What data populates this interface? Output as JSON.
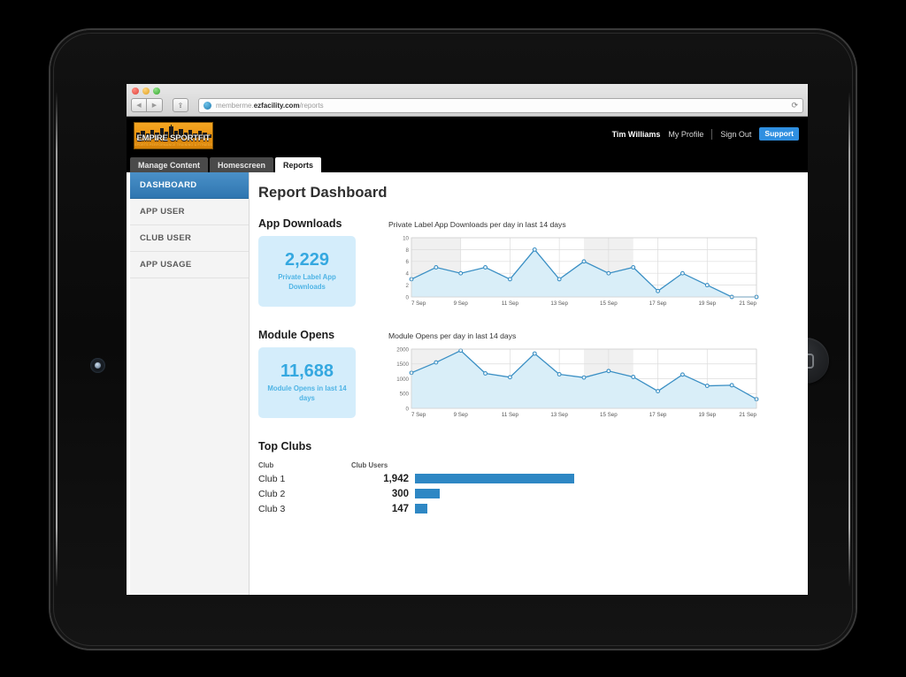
{
  "browser": {
    "url_sub": "memberme.",
    "url_host": "ezfacility.com",
    "url_path": "/reports",
    "back_icon": "◀",
    "forward_icon": "▶",
    "share_icon": "⇪",
    "reload_icon": "⟳"
  },
  "header": {
    "logo_text": "EMPIRE SPORTFIT",
    "logo_sub": "SPORTS PERFORMANCE TRAINING & FITNESS",
    "user_name": "Tim Williams",
    "my_profile": "My Profile",
    "sign_out": "Sign Out",
    "support": "Support",
    "support_color": "#2f8fe0"
  },
  "tabs": [
    {
      "label": "Manage Content",
      "active": false
    },
    {
      "label": "Homescreen",
      "active": false
    },
    {
      "label": "Reports",
      "active": true
    }
  ],
  "sidebar": {
    "items": [
      {
        "label": "DASHBOARD",
        "active": true
      },
      {
        "label": "APP USER",
        "active": false
      },
      {
        "label": "CLUB USER",
        "active": false
      },
      {
        "label": "APP USAGE",
        "active": false
      }
    ],
    "active_color": "#2f76b0"
  },
  "main": {
    "page_title": "Report Dashboard",
    "app_downloads": {
      "heading": "App Downloads",
      "stat_number": "2,229",
      "stat_caption": "Private Label App Downloads"
    },
    "module_opens": {
      "heading": "Module Opens",
      "stat_number": "11,688",
      "stat_caption": "Module Opens in last 14 days"
    },
    "top_clubs": {
      "heading": "Top Clubs",
      "col_club": "Club",
      "col_users": "Club Users"
    }
  },
  "chart_data": [
    {
      "type": "area",
      "title": "Private Label App Downloads per day in last 14 days",
      "xlabel": "",
      "ylabel": "",
      "categories": [
        "7 Sep",
        "8 Sep",
        "9 Sep",
        "10 Sep",
        "11 Sep",
        "12 Sep",
        "13 Sep",
        "14 Sep",
        "15 Sep",
        "16 Sep",
        "17 Sep",
        "18 Sep",
        "19 Sep",
        "20 Sep",
        "21 Sep"
      ],
      "values": [
        3,
        5,
        4,
        5,
        3,
        8,
        3,
        6,
        4,
        5,
        1,
        4,
        2,
        0,
        0
      ],
      "xticks": [
        "7 Sep",
        "9 Sep",
        "11 Sep",
        "13 Sep",
        "15 Sep",
        "17 Sep",
        "19 Sep",
        "21 Sep"
      ],
      "yticks": [
        0,
        2,
        4,
        6,
        8,
        10
      ],
      "ylim": [
        0,
        10
      ],
      "grid": true,
      "legend": "none",
      "line_color": "#3a8fc4",
      "fill_color": "#d9eef8",
      "marker": "open-circle",
      "weekend_bands": [
        [
          0,
          2
        ],
        [
          7,
          9
        ]
      ]
    },
    {
      "type": "area",
      "title": "Module Opens per day in last 14 days",
      "xlabel": "",
      "ylabel": "",
      "categories": [
        "7 Sep",
        "8 Sep",
        "9 Sep",
        "10 Sep",
        "11 Sep",
        "12 Sep",
        "13 Sep",
        "14 Sep",
        "15 Sep",
        "16 Sep",
        "17 Sep",
        "18 Sep",
        "19 Sep",
        "20 Sep",
        "21 Sep"
      ],
      "values": [
        1200,
        1550,
        1950,
        1180,
        1050,
        1850,
        1150,
        1040,
        1260,
        1060,
        580,
        1140,
        760,
        780,
        310
      ],
      "xticks": [
        "7 Sep",
        "9 Sep",
        "11 Sep",
        "13 Sep",
        "15 Sep",
        "17 Sep",
        "19 Sep",
        "21 Sep"
      ],
      "yticks": [
        0,
        500,
        1000,
        1500,
        2000
      ],
      "ylim": [
        0,
        2000
      ],
      "grid": true,
      "legend": "none",
      "line_color": "#3a8fc4",
      "fill_color": "#d9eef8",
      "marker": "open-circle",
      "weekend_bands": [
        [
          0,
          2
        ],
        [
          7,
          9
        ]
      ]
    },
    {
      "type": "bar",
      "title": "Top Clubs",
      "orientation": "horizontal",
      "categories": [
        "Club 1",
        "Club 2",
        "Club 3"
      ],
      "values": [
        1942,
        300,
        147
      ],
      "value_labels": [
        "1,942",
        "300",
        "147"
      ],
      "bar_color": "#2e87c4",
      "max_value": 1942
    }
  ]
}
